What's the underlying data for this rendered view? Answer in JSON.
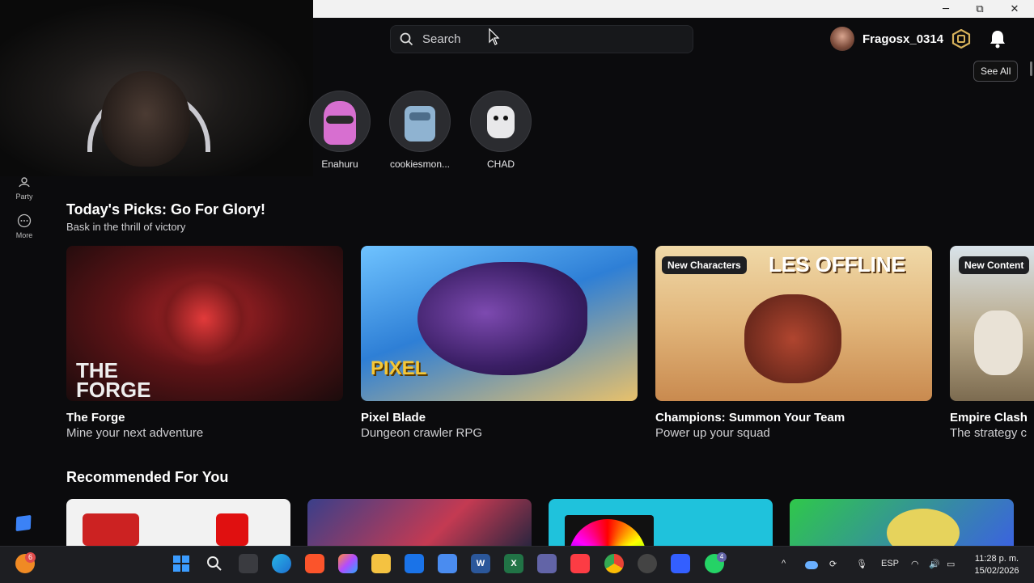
{
  "window": {
    "minimize": "─",
    "maximize": "⧉",
    "close": "✕"
  },
  "search": {
    "placeholder": "Search"
  },
  "user": {
    "name": "Fragosx_0314"
  },
  "sidebar": {
    "items": [
      {
        "label": "Party",
        "icon": "party-icon"
      },
      {
        "label": "More",
        "icon": "more-icon"
      }
    ]
  },
  "friends": {
    "see_all": "See All",
    "items": [
      {
        "name": "Enahuru",
        "color": "#c05fb4"
      },
      {
        "name": "cookiesmon...",
        "color": "#6a8fb0"
      },
      {
        "name": "CHAD",
        "color": "#2c2c2e"
      }
    ]
  },
  "todays_picks": {
    "title": "Today's Picks: Go For Glory!",
    "subtitle": "Bask in the thrill of victory",
    "cards": [
      {
        "title": "The Forge",
        "subtitle": "Mine your next adventure",
        "badge": "",
        "art_text": "THE FORGE"
      },
      {
        "title": "Pixel Blade",
        "subtitle": "Dungeon crawler RPG",
        "badge": "",
        "art_text": "PIXEL"
      },
      {
        "title": "Champions: Summon Your Team",
        "subtitle": "Power up your squad",
        "badge": "New Characters",
        "art_text": "LES OFFLINE"
      },
      {
        "title": "Empire Clash",
        "subtitle": "The strategy c",
        "badge": "New Content",
        "art_text": ""
      }
    ]
  },
  "recommended": {
    "title": "Recommended For You"
  },
  "taskbar": {
    "notification_count": "6",
    "teams_count": "4",
    "word_label": "W",
    "excel_label": "X",
    "language": "ESP",
    "time": "11:28 p. m.",
    "date": "15/02/2026"
  },
  "colors": {
    "accent": "#3b82f6",
    "background": "#0b0b0d",
    "card_bg": "#17181b"
  }
}
